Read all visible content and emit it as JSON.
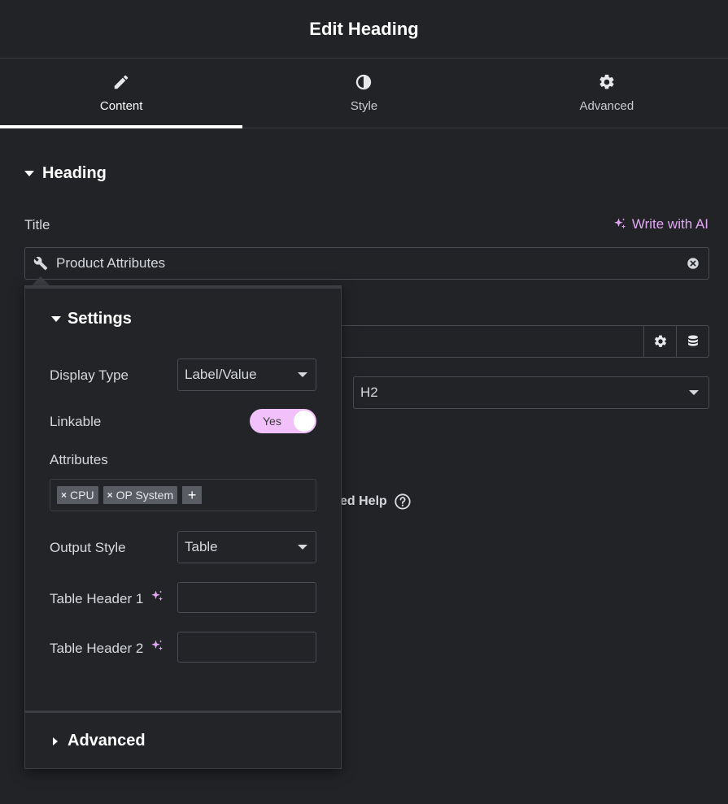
{
  "header": {
    "title": "Edit Heading"
  },
  "tabs": [
    {
      "label": "Content",
      "icon": "pencil-icon"
    },
    {
      "label": "Style",
      "icon": "half-circle-icon"
    },
    {
      "label": "Advanced",
      "icon": "gear-icon"
    }
  ],
  "section": {
    "title": "Heading"
  },
  "title_field": {
    "label": "Title",
    "ai_label": "Write with AI",
    "value": "Product Attributes"
  },
  "size_select": {
    "value": "H2"
  },
  "help": {
    "text": "ed Help"
  },
  "popup": {
    "title": "Settings",
    "display_type": {
      "label": "Display Type",
      "value": "Label/Value"
    },
    "linkable": {
      "label": "Linkable",
      "toggle_text": "Yes"
    },
    "attributes": {
      "label": "Attributes",
      "tags": [
        "CPU",
        "OP System"
      ]
    },
    "output_style": {
      "label": "Output Style",
      "value": "Table"
    },
    "table_header_1": {
      "label": "Table Header 1"
    },
    "table_header_2": {
      "label": "Table Header 2"
    },
    "advanced": "Advanced"
  },
  "colors": {
    "background": "#222327",
    "accent_ai": "#e2a7f3",
    "toggle_on": "#f2c0fa"
  }
}
